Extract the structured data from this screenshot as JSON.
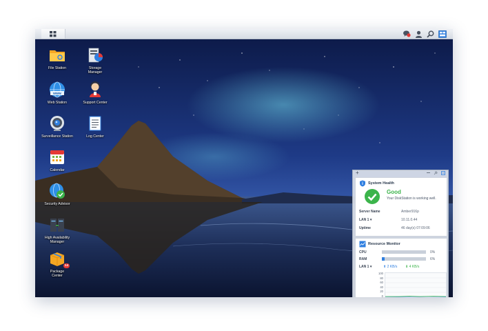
{
  "taskbar": {
    "icons": [
      "main-menu-icon",
      "notification-icon",
      "user-icon",
      "search-icon",
      "widgets-icon"
    ]
  },
  "desktop": {
    "apps": [
      {
        "label": "File Station",
        "icon": "folder-icon"
      },
      {
        "label": "Storage\nManager",
        "icon": "storage-manager-icon"
      },
      {
        "label": "Web Station",
        "icon": "web-station-icon"
      },
      {
        "label": "Support Center",
        "icon": "support-center-icon"
      },
      {
        "label": "Surveillance Station",
        "icon": "surveillance-camera-icon"
      },
      {
        "label": "Log Center",
        "icon": "log-center-icon"
      },
      {
        "label": "Calendar",
        "icon": "calendar-icon"
      },
      {
        "label": "Security Advisor",
        "icon": "security-advisor-icon"
      },
      {
        "label": "High Availability\nManager",
        "icon": "high-availability-icon"
      },
      {
        "label": "Package\nCenter",
        "icon": "package-center-icon",
        "badge": "14"
      }
    ]
  },
  "widgets": {
    "add_symbol": "+",
    "health": {
      "title": "System Health",
      "status": "Good",
      "status_detail": "Your DiskStation is working well.",
      "rows": [
        {
          "key": "Server Name",
          "value": "Amber916p"
        },
        {
          "key": "LAN 1 ▾",
          "value": "10.11.0.44"
        },
        {
          "key": "Uptime",
          "value": "46 day(s) 07:09:06"
        }
      ]
    },
    "resource": {
      "title": "Resource Monitor",
      "cpu_label": "CPU",
      "cpu_value": "0%",
      "cpu_fraction": 0.0,
      "ram_label": "RAM",
      "ram_value": "6%",
      "ram_fraction": 0.06,
      "lan_label": "LAN 1 ▾",
      "upload": "2 KB/s",
      "download": "4 KB/s",
      "y_ticks": [
        "100",
        "80",
        "60",
        "40",
        "20",
        "0"
      ],
      "colors": {
        "upload": "#2f7fe0",
        "download": "#3cb44b"
      }
    }
  }
}
